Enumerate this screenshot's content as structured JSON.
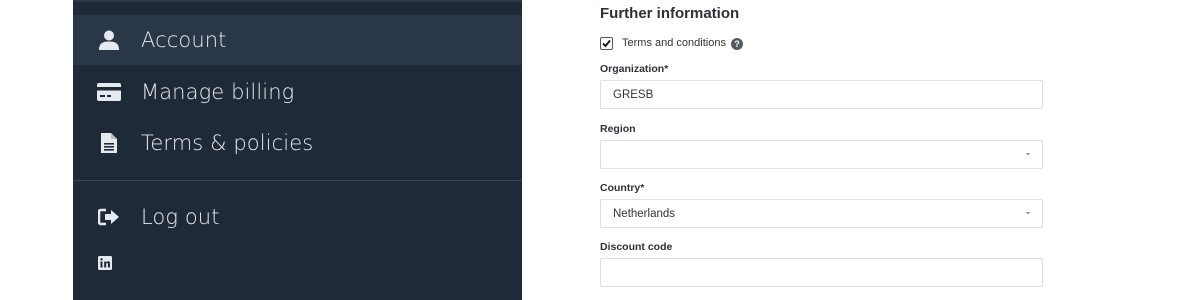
{
  "sidebar": {
    "items": [
      {
        "label": "Account",
        "icon": "user-icon",
        "active": true
      },
      {
        "label": "Manage billing",
        "icon": "credit-card-icon"
      },
      {
        "label": "Terms & policies",
        "icon": "document-icon"
      },
      {
        "label": "Log out",
        "icon": "sign-out-icon"
      }
    ],
    "social_icon": "linkedin-icon"
  },
  "form": {
    "title": "Further information",
    "terms": {
      "label": "Terms and conditions",
      "checked": true,
      "help_icon": "question-circle-icon"
    },
    "organization": {
      "label": "Organization*",
      "value": "GRESB"
    },
    "region": {
      "label": "Region",
      "value": ""
    },
    "country": {
      "label": "Country*",
      "value": "Netherlands"
    },
    "discount": {
      "label": "Discount code",
      "value": ""
    }
  },
  "colors": {
    "sidebar_bg": "#1f2a38",
    "sidebar_active": "#2a3748",
    "text_light": "#e6e9ee"
  }
}
